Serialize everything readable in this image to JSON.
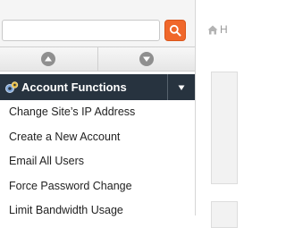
{
  "search": {
    "value": "",
    "placeholder": "",
    "button_icon": "search-icon"
  },
  "scroll_controls": {
    "up_icon": "chevron-up-icon",
    "down_icon": "chevron-down-icon"
  },
  "sidebar": {
    "group": {
      "icon": "account-functions-icon",
      "title": "Account Functions",
      "toggle_icon": "caret-down-icon"
    },
    "items": [
      {
        "label": "Change Site’s IP Address"
      },
      {
        "label": "Create a New Account"
      },
      {
        "label": "Email All Users"
      },
      {
        "label": "Force Password Change"
      },
      {
        "label": "Limit Bandwidth Usage"
      }
    ]
  },
  "breadcrumb": {
    "home_icon": "home-icon",
    "text": "H"
  },
  "colors": {
    "search_button": "#f0672a",
    "group_header_bg": "#27333f"
  }
}
